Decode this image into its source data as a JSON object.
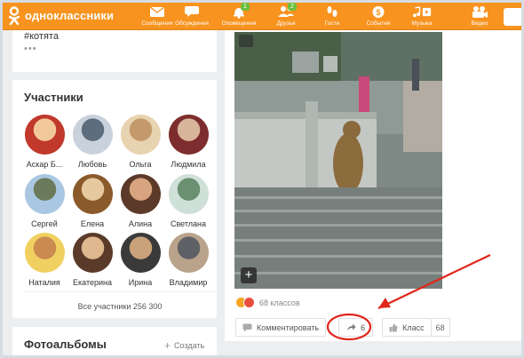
{
  "app": {
    "logo_text": "одноклассники"
  },
  "nav": [
    {
      "label": "Сообщения",
      "icon": "envelope-icon",
      "badge": ""
    },
    {
      "label": "Обсуждения",
      "icon": "chat-icon",
      "badge": ""
    },
    {
      "label": "Оповещения",
      "icon": "bell-icon",
      "badge": "1"
    },
    {
      "label": "Друзья",
      "icon": "friends-icon",
      "badge": "2"
    },
    {
      "label": "Гости",
      "icon": "footprints-icon",
      "badge": ""
    },
    {
      "label": "События",
      "icon": "events-icon",
      "badge": ""
    },
    {
      "label": "Музыка",
      "icon": "music-icon",
      "badge": ""
    },
    {
      "label": "Видео",
      "icon": "video-icon",
      "badge": ""
    }
  ],
  "post": {
    "hashtag": "#котята",
    "more": "•••"
  },
  "participants": {
    "title": "Участники",
    "members": [
      {
        "name": "Аскар Б..."
      },
      {
        "name": "Любовь"
      },
      {
        "name": "Ольга"
      },
      {
        "name": "Людмила"
      },
      {
        "name": "Сергей"
      },
      {
        "name": "Елена"
      },
      {
        "name": "Алина"
      },
      {
        "name": "Светлана"
      },
      {
        "name": "Наталия"
      },
      {
        "name": "Екатерина"
      },
      {
        "name": "Ирина"
      },
      {
        "name": "Владимир"
      }
    ],
    "all_link": "Все участники 256 300"
  },
  "albums": {
    "title": "Фотоальбомы",
    "add_label": "Создать"
  },
  "video_post": {
    "plus": "+",
    "likes_text": "68 классов",
    "comment_label": "Комментировать",
    "share_count": "6",
    "class_label": "Класс",
    "class_count": "68"
  },
  "colors": {
    "brand": "#f7931e",
    "annotation": "#e1261c"
  }
}
